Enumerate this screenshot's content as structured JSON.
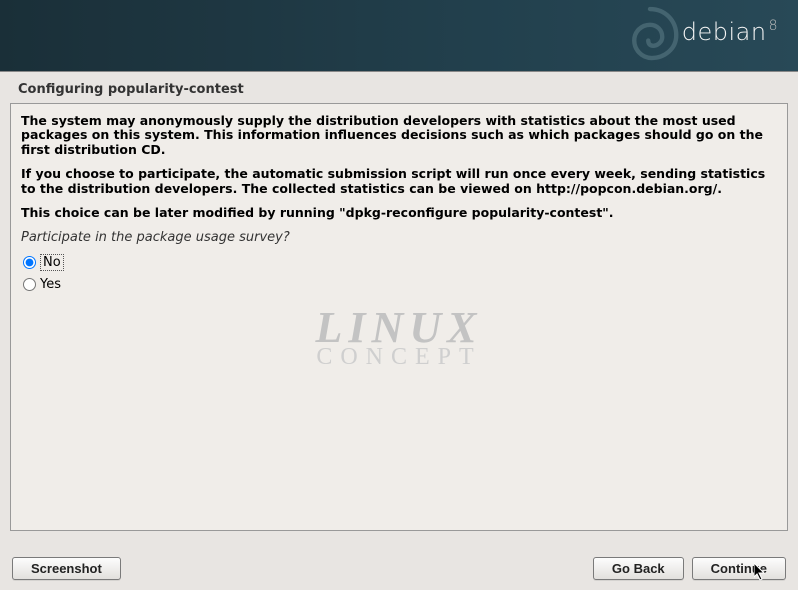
{
  "brand": {
    "name": "debian",
    "version": "8"
  },
  "title": "Configuring popularity-contest",
  "description": {
    "p1": "The system may anonymously supply the distribution developers with statistics about the most used packages on this system. This information influences decisions such as which packages should go on the first distribution CD.",
    "p2": "If you choose to participate, the automatic submission script will run once every week, sending statistics to the distribution developers. The collected statistics can be viewed on http://popcon.debian.org/.",
    "p3": "This choice can be later modified by running \"dpkg-reconfigure popularity-contest\"."
  },
  "question": "Participate in the package usage survey?",
  "options": {
    "no": "No",
    "yes": "Yes",
    "selected": "no"
  },
  "buttons": {
    "screenshot": "Screenshot",
    "goback": "Go Back",
    "continue": "Continue"
  },
  "watermark": {
    "line1": "LINUX",
    "line2": "CONCEPT"
  }
}
